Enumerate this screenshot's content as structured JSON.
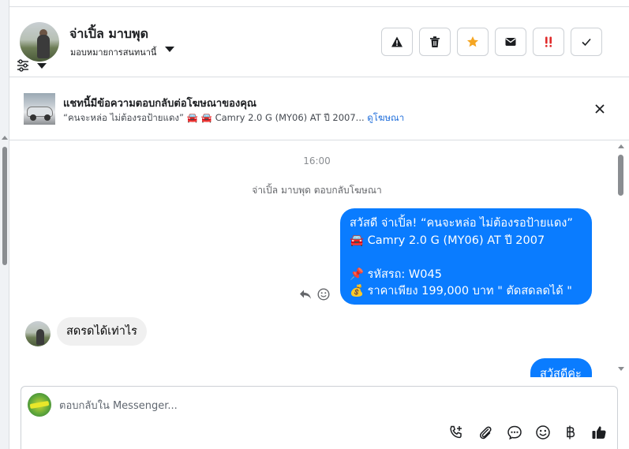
{
  "header": {
    "contact_name": "จ่าเปิ้ล มาบพุด",
    "assign_label": "มอบหมายการสนทนานี้",
    "actions": [
      {
        "name": "spam-warning",
        "icon": "warning-icon"
      },
      {
        "name": "delete",
        "icon": "trash-icon"
      },
      {
        "name": "star",
        "icon": "star-icon",
        "color": "#f5a623"
      },
      {
        "name": "mark-unread",
        "icon": "envelope-icon"
      },
      {
        "name": "follow-up",
        "icon": "double-exclamation-icon",
        "color": "#e02a2a"
      },
      {
        "name": "mark-done",
        "icon": "checkmark-icon"
      }
    ]
  },
  "ad_banner": {
    "title": "แชทนี้มีข้อความตอบกลับต่อโฆษณาของคุณ",
    "subtitle": "“คนจะหล่อ ไม่ต้องรอป้ายแดง” 🚘 🚘 Camry 2.0 G (MY06) AT ปี 2007...",
    "link_label": "ดูโฆษณา"
  },
  "chat": {
    "timestamp": "16:00",
    "system_message": "จ่าเปิ้ล มาบพุด ตอบกลับโฆษณา",
    "outgoing_message_lines": [
      "สวัสดี จ่าเปิ้ล! “คนจะหล่อ ไม่ต้องรอป้ายแดง”",
      "🚘 Camry 2.0 G (MY06) AT ปี 2007",
      "",
      "📌 รหัสรถ: W045",
      "💰 ราคาเพียง 199,000 บาท \" ตัดสดลดได้ \""
    ],
    "incoming_message": "สดรดได้เท่าไร",
    "outgoing_message_2": "สวัสดีค่ะ"
  },
  "composer": {
    "placeholder": "ตอบกลับใน Messenger...",
    "tools": [
      "phone-plus-icon",
      "paperclip-icon",
      "saved-replies-icon",
      "emoji-icon",
      "baht-icon",
      "thumbs-up-icon"
    ]
  },
  "colors": {
    "accent": "#0a7cff",
    "link": "#216fdb",
    "star": "#f5a623",
    "follow_up": "#e02a2a"
  }
}
